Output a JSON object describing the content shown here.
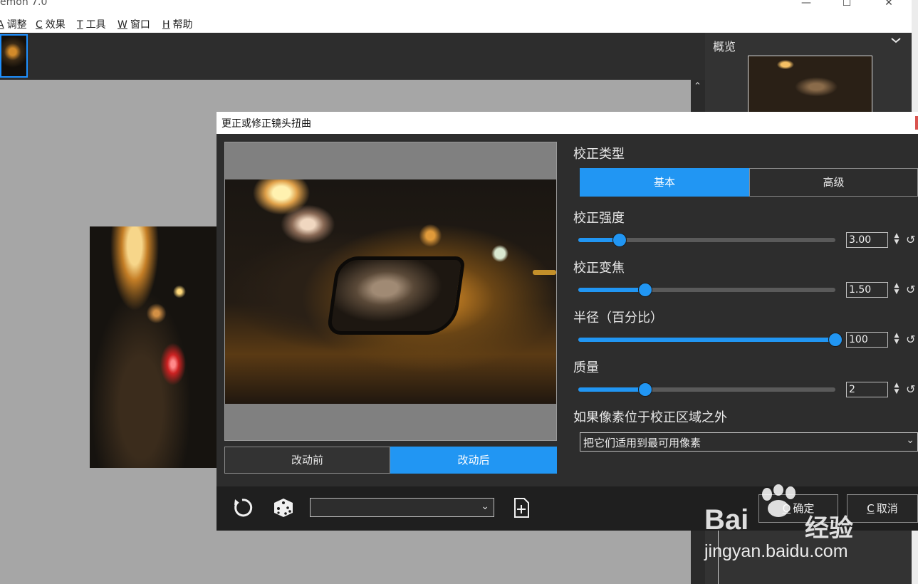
{
  "app": {
    "title": "emon 7.0",
    "window_controls": [
      "—",
      "☐",
      "✕"
    ],
    "menu": [
      {
        "key": "A",
        "label": "调整"
      },
      {
        "key": "C",
        "label": "效果"
      },
      {
        "key": "T",
        "label": "工具"
      },
      {
        "key": "W",
        "label": "窗口"
      },
      {
        "key": "H",
        "label": "帮助"
      }
    ],
    "nav_panel": {
      "title": "概览"
    },
    "scroll_up": "⌃"
  },
  "dialog": {
    "title": "更正或修正镜头扭曲",
    "before_label": "改动前",
    "after_label": "改动后",
    "correction_type": {
      "label": "校正类型",
      "tabs": [
        "基本",
        "高级"
      ],
      "selected": "基本"
    },
    "params": [
      {
        "label": "校正强度",
        "value": "3.00",
        "level": 0.16
      },
      {
        "label": "校正变焦",
        "value": "1.50",
        "level": 0.26
      },
      {
        "label": "半径（百分比）",
        "value": "100",
        "level": 1.0
      },
      {
        "label": "质量",
        "value": "2",
        "level": 0.26
      }
    ],
    "outside": {
      "label": "如果像素位于校正区域之外",
      "value": "把它们适用到最可用像素"
    },
    "footer": {
      "preset_value": "",
      "ok": {
        "key": "O",
        "label": "确定"
      },
      "cancel": {
        "key": "C",
        "label": "取消"
      }
    }
  },
  "watermark": {
    "brand": "Bai",
    "cn": "经验",
    "url": "jingyan.baidu.com"
  },
  "colors": {
    "accent": "#2196f3",
    "panel": "#2d2d2d",
    "footer": "#1f1f1f"
  }
}
